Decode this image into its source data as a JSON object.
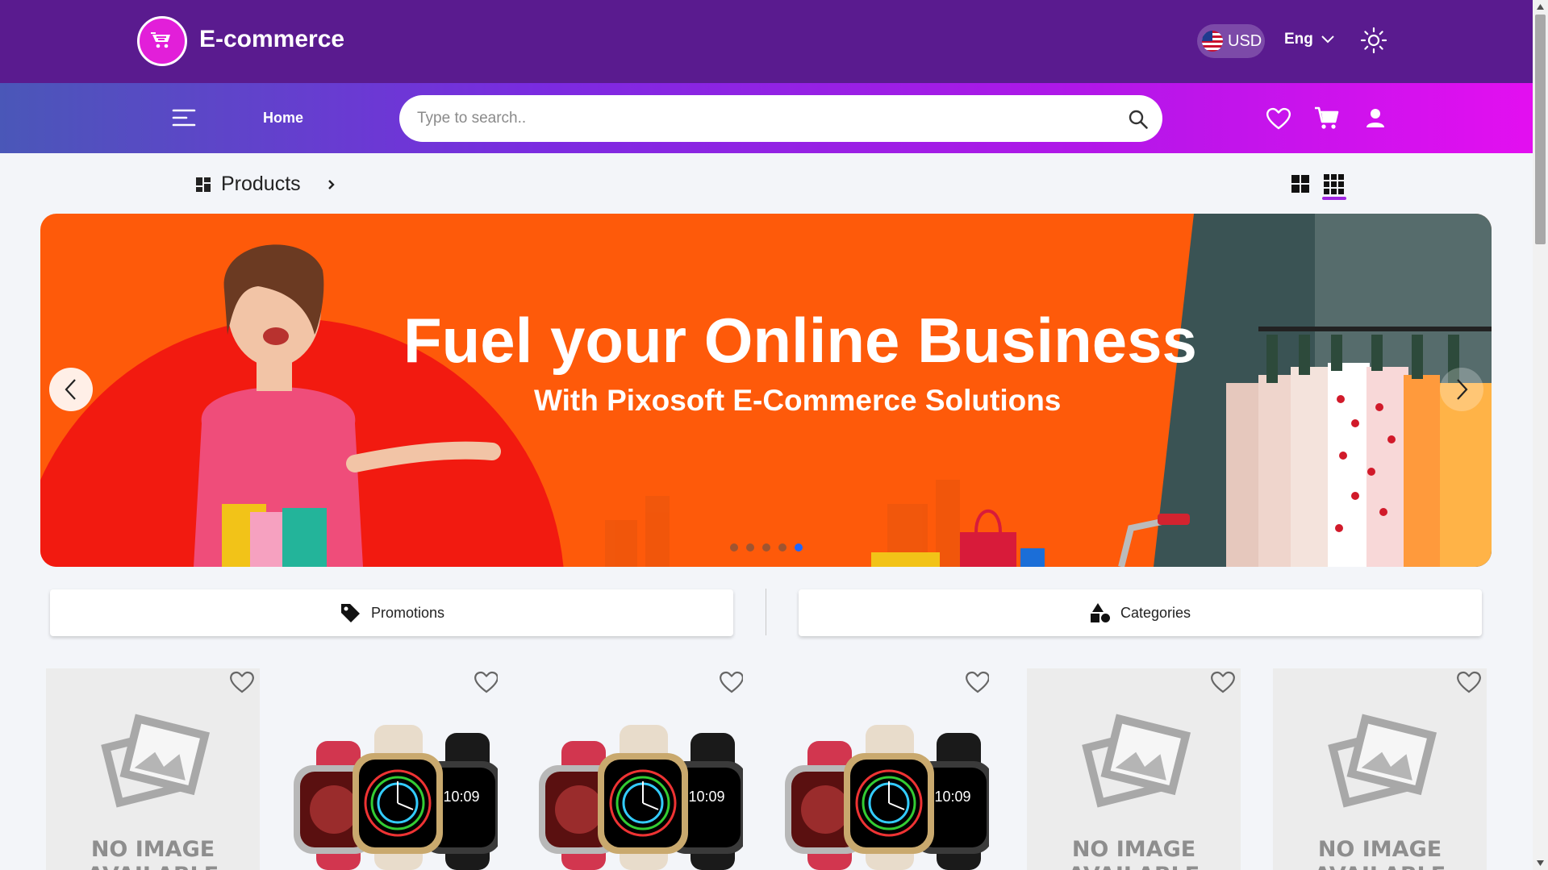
{
  "header": {
    "brand": "E-commerce",
    "currency": "USD",
    "language": "Eng",
    "icons": [
      "logo-icon",
      "us-flag-icon",
      "chevron-down-icon",
      "sun-icon"
    ]
  },
  "nav": {
    "home_label": "Home",
    "search_placeholder": "Type to search..",
    "icons": [
      "menu-icon",
      "search-icon",
      "heart-icon",
      "cart-icon",
      "user-icon"
    ]
  },
  "breadcrumb": {
    "title": "Products"
  },
  "banner": {
    "title": "Fuel your Online Business",
    "subtitle": "With Pixosoft E-Commerce Solutions",
    "slide_count": 5,
    "active_slide": 5,
    "colors": {
      "background": "#fe5a0a",
      "circle": "#f21a10"
    }
  },
  "tabs": {
    "promotions": "Promotions",
    "categories": "Categories"
  },
  "products": [
    {
      "image": "no-image",
      "placeholder_text": "NO IMAGE AVAILABLE"
    },
    {
      "image": "apple-watch"
    },
    {
      "image": "apple-watch"
    },
    {
      "image": "apple-watch"
    },
    {
      "image": "no-image",
      "placeholder_text": "NO IMAGE AVAILABLE"
    },
    {
      "image": "no-image",
      "placeholder_text": "NO IMAGE AVAILABLE"
    }
  ],
  "colors": {
    "topbar": "#5a1b8f",
    "accent": "#e21fd9",
    "nav_gradient_start": "#4a57b8",
    "nav_gradient_end": "#e30ff0",
    "active_dot": "#1e66ff"
  }
}
